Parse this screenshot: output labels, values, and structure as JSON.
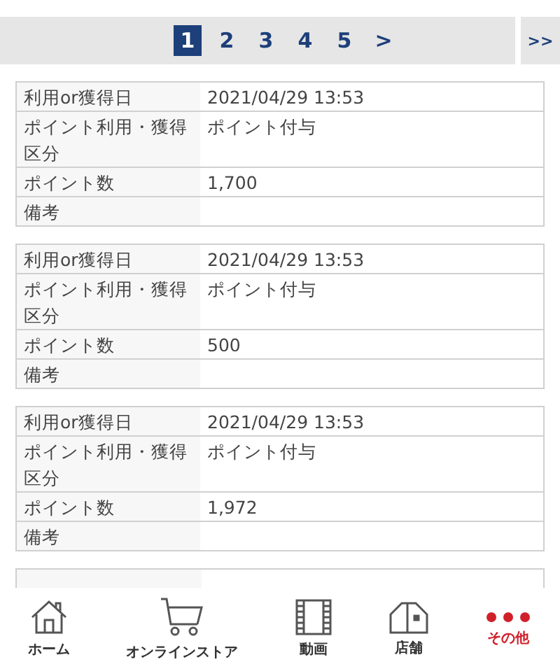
{
  "pager": {
    "pages": [
      {
        "label": "1",
        "selected": true
      },
      {
        "label": "2",
        "selected": false
      },
      {
        "label": "3",
        "selected": false
      },
      {
        "label": "4",
        "selected": false
      },
      {
        "label": "5",
        "selected": false
      }
    ],
    "next": ">",
    "last": ">>"
  },
  "records": [
    {
      "rows": [
        {
          "label": "利用or獲得日",
          "value": "2021/04/29 13:53"
        },
        {
          "label": "ポイント利用・獲得区分",
          "value": "ポイント付与"
        },
        {
          "label": "ポイント数",
          "value": "1,700"
        },
        {
          "label": "備考"
        }
      ]
    },
    {
      "rows": [
        {
          "label": "利用or獲得日",
          "value": "2021/04/29 13:53"
        },
        {
          "label": "ポイント利用・獲得区分",
          "value": "ポイント付与"
        },
        {
          "label": "ポイント数",
          "value": "500"
        },
        {
          "label": "備考"
        }
      ]
    },
    {
      "rows": [
        {
          "label": "利用or獲得日",
          "value": "2021/04/29 13:53"
        },
        {
          "label": "ポイント利用・獲得区分",
          "value": "ポイント付与"
        },
        {
          "label": "ポイント数",
          "value": "1,972"
        },
        {
          "label": "備考"
        }
      ]
    }
  ],
  "tab_bar": [
    {
      "kind": "home",
      "label": "ホーム",
      "selected": false
    },
    {
      "kind": "cart",
      "label": "オンラインストア",
      "selected": false
    },
    {
      "kind": "film",
      "label": "動画",
      "selected": false
    },
    {
      "kind": "store",
      "label": "店舗",
      "selected": false
    },
    {
      "kind": "more",
      "label": "その他",
      "selected": true
    }
  ]
}
